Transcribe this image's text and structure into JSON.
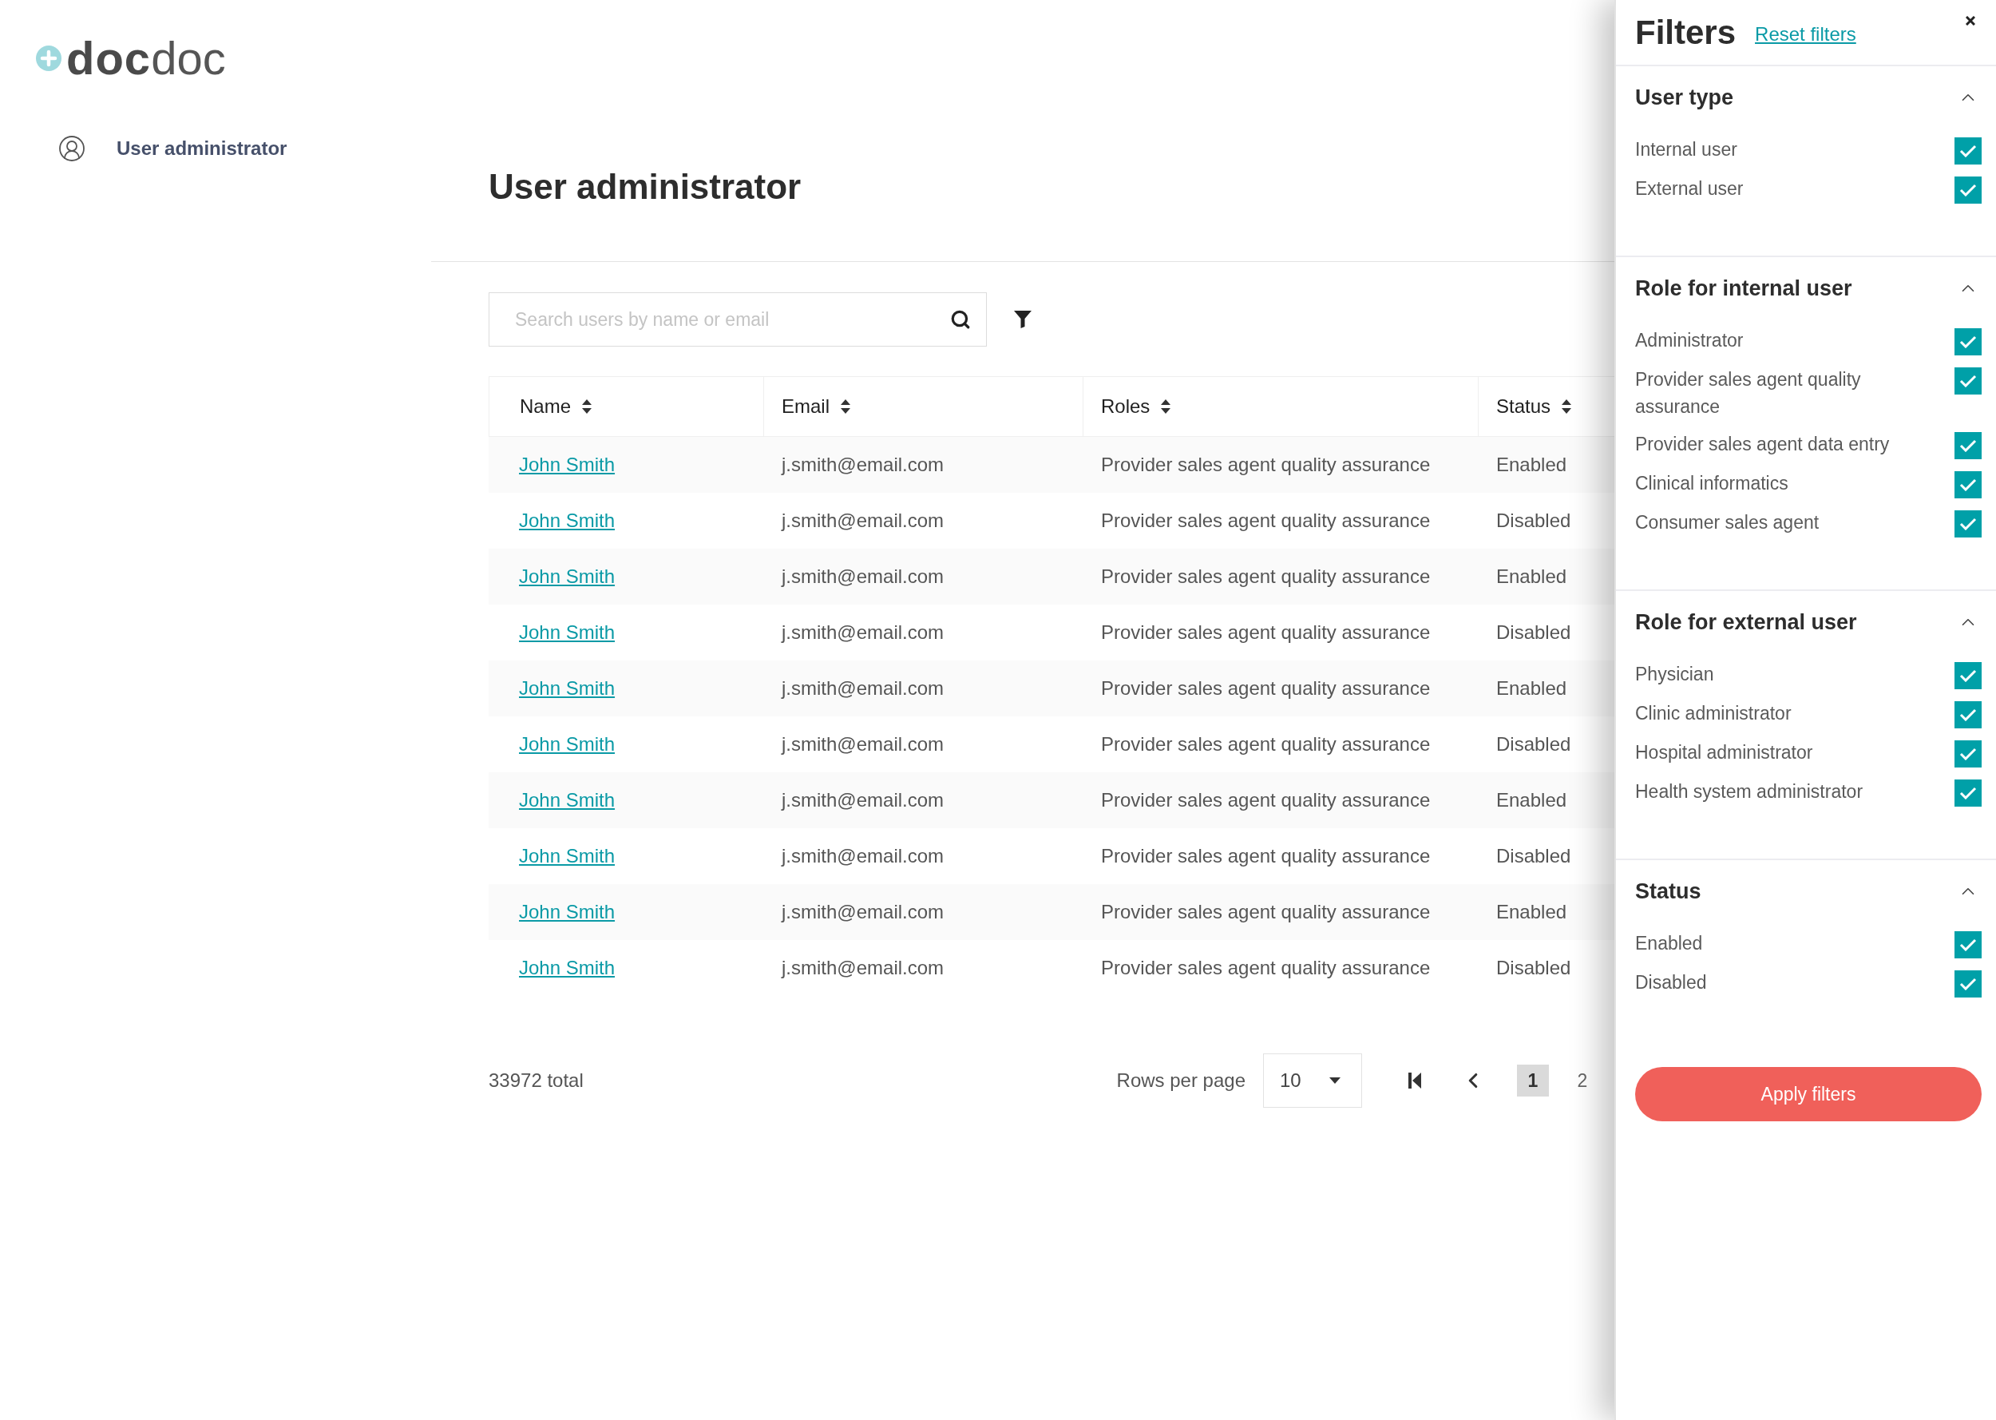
{
  "logo": {
    "bold": "doc",
    "light": "doc"
  },
  "sidebar": {
    "items": [
      {
        "label": "User administrator"
      }
    ]
  },
  "page_title": "User administrator",
  "search": {
    "placeholder": "Search users by name or email"
  },
  "table": {
    "columns": [
      "Name",
      "Email",
      "Roles",
      "Status"
    ],
    "rows": [
      {
        "name": "John Smith",
        "email": "j.smith@email.com",
        "roles": "Provider sales agent quality assurance",
        "status": "Enabled"
      },
      {
        "name": "John Smith",
        "email": "j.smith@email.com",
        "roles": "Provider sales agent quality assurance",
        "status": "Disabled"
      },
      {
        "name": "John Smith",
        "email": "j.smith@email.com",
        "roles": "Provider sales agent quality assurance",
        "status": "Enabled"
      },
      {
        "name": "John Smith",
        "email": "j.smith@email.com",
        "roles": "Provider sales agent quality assurance",
        "status": "Disabled"
      },
      {
        "name": "John Smith",
        "email": "j.smith@email.com",
        "roles": "Provider sales agent quality assurance",
        "status": "Enabled"
      },
      {
        "name": "John Smith",
        "email": "j.smith@email.com",
        "roles": "Provider sales agent quality assurance",
        "status": "Disabled"
      },
      {
        "name": "John Smith",
        "email": "j.smith@email.com",
        "roles": "Provider sales agent quality assurance",
        "status": "Enabled"
      },
      {
        "name": "John Smith",
        "email": "j.smith@email.com",
        "roles": "Provider sales agent quality assurance",
        "status": "Disabled"
      },
      {
        "name": "John Smith",
        "email": "j.smith@email.com",
        "roles": "Provider sales agent quality assurance",
        "status": "Enabled"
      },
      {
        "name": "John Smith",
        "email": "j.smith@email.com",
        "roles": "Provider sales agent quality assurance",
        "status": "Disabled"
      }
    ]
  },
  "pagination": {
    "total": "33972 total",
    "rows_per_page_label": "Rows per page",
    "rows_per_page": "10",
    "pages": [
      {
        "label": "1",
        "selected": true
      },
      {
        "label": "2",
        "selected": false
      }
    ]
  },
  "filters": {
    "title": "Filters",
    "reset": "Reset filters",
    "sections": [
      {
        "title": "User type",
        "expanded": true,
        "options": [
          {
            "label": "Internal user",
            "checked": true
          },
          {
            "label": "External user",
            "checked": true
          }
        ]
      },
      {
        "title": "Role for internal user",
        "expanded": true,
        "options": [
          {
            "label": "Administrator",
            "checked": true
          },
          {
            "label": "Provider sales agent quality assurance",
            "checked": true
          },
          {
            "label": "Provider sales agent data entry",
            "checked": true
          },
          {
            "label": "Clinical informatics",
            "checked": true
          },
          {
            "label": "Consumer sales agent",
            "checked": true
          }
        ]
      },
      {
        "title": "Role for external user",
        "expanded": true,
        "options": [
          {
            "label": "Physician",
            "checked": true
          },
          {
            "label": "Clinic administrator",
            "checked": true
          },
          {
            "label": "Hospital administrator",
            "checked": true
          },
          {
            "label": "Health system administrator",
            "checked": true
          }
        ]
      },
      {
        "title": "Status",
        "expanded": true,
        "options": [
          {
            "label": "Enabled",
            "checked": true
          },
          {
            "label": "Disabled",
            "checked": true
          }
        ]
      }
    ],
    "apply_button": "Apply filters"
  }
}
